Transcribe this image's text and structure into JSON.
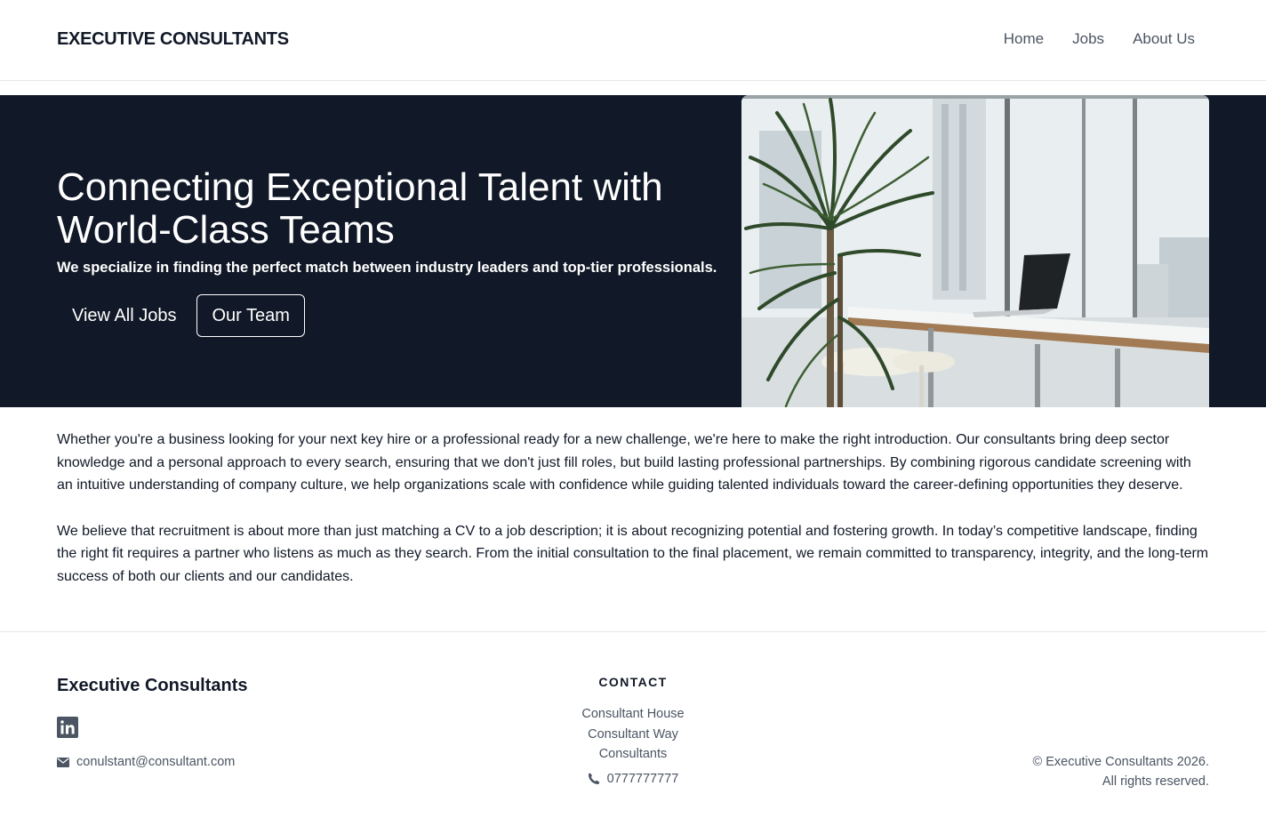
{
  "header": {
    "brand": "EXECUTIVE CONSULTANTS",
    "nav": [
      "Home",
      "Jobs",
      "About Us"
    ]
  },
  "hero": {
    "title": "Connecting Exceptional Talent with World-Class Teams",
    "subtitle": "We specialize in finding the perfect match between industry leaders and top-tier professionals.",
    "primary_button": "View All Jobs",
    "secondary_button": "Our Team",
    "image": "office-with-plant-and-laptop-photo"
  },
  "content": {
    "paragraphs": [
      "Whether you're a business looking for your next key hire or a professional ready for a new challenge, we're here to make the right introduction. Our consultants bring deep sector knowledge and a personal approach to every search, ensuring that we don't just fill roles, but build lasting professional partnerships. By combining rigorous candidate screening with an intuitive understanding of company culture, we help organizations scale with confidence while guiding talented individuals toward the career-defining opportunities they deserve.",
      "We believe that recruitment is about more than just matching a CV to a job description; it is about recognizing potential and fostering growth. In today’s competitive landscape, finding the right fit requires a partner who listens as much as they search. From the initial consultation to the final placement, we remain committed to transparency, integrity, and the long-term success of both our clients and our candidates."
    ]
  },
  "footer": {
    "brand": "Executive Consultants",
    "social_icon": "linkedin-icon",
    "email": "conulstant@consultant.com",
    "contact_title": "CONTACT",
    "address": [
      "Consultant House",
      "Consultant Way",
      "Consultants"
    ],
    "phone": "0777777777",
    "copyright": "© Executive Consultants 2026.",
    "rights": "All rights reserved."
  },
  "colors": {
    "hero_bg": "#111827",
    "text_dark": "#111827",
    "text_muted": "#4b5563",
    "border": "#e5e7eb"
  }
}
